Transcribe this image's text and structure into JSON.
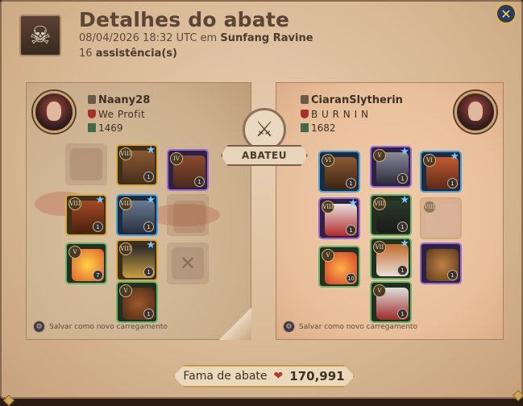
{
  "header": {
    "title": "Detalhes do abate",
    "datetime": "08/04/2026 18:32 UTC em",
    "location": "Sunfang Ravine",
    "assists_count": "16",
    "assists_label": "assistência(s)"
  },
  "center": {
    "label": "ABATEU"
  },
  "killer": {
    "name": "Naany28",
    "guild": "We Profit",
    "ip": "1469",
    "save_label": "Salvar como novo carregamento"
  },
  "victim": {
    "name": "CiaranSlytherin",
    "guild": "B U R N I N",
    "ip": "1682",
    "save_label": "Salvar como novo carregamento"
  },
  "killer_items": {
    "bag": {
      "tier": "",
      "count": ""
    },
    "head": {
      "tier": "VIII",
      "count": "1"
    },
    "cape": {
      "tier": "IV",
      "count": "1"
    },
    "weapon": {
      "tier": "VIII",
      "count": "1"
    },
    "armor": {
      "tier": "VIII",
      "count": "1"
    },
    "offhand": {
      "tier": "",
      "count": ""
    },
    "potion": {
      "tier": "V",
      "count": "7"
    },
    "shoes": {
      "tier": "VIII",
      "count": "1"
    },
    "food": {
      "tier": "",
      "count": ""
    },
    "mount": {
      "tier": "V",
      "count": "1"
    }
  },
  "victim_items": {
    "bag": {
      "tier": "VI",
      "count": "1"
    },
    "head": {
      "tier": "V",
      "count": "1"
    },
    "cape": {
      "tier": "VI",
      "count": "1"
    },
    "weapon": {
      "tier": "VIII",
      "count": "1"
    },
    "armor": {
      "tier": "VIII",
      "count": "1"
    },
    "offhand": {
      "tier": "VIII",
      "count": ""
    },
    "potion": {
      "tier": "V",
      "count": "10"
    },
    "shoes": {
      "tier": "VII",
      "count": "1"
    },
    "food": {
      "tier": "",
      "count": "1"
    },
    "mount": {
      "tier": "V",
      "count": "1"
    }
  },
  "fame": {
    "label": "Fama de abate",
    "value": "170,991"
  },
  "icons": {
    "header": "skull-crossbones-icon",
    "close": "close-icon",
    "center": "crossed-swords-icon",
    "fame": "kill-fame-icon",
    "save": "save-loadout-icon"
  },
  "colors": {
    "tier_blue": "#4aa0d6",
    "tier_purple": "#9b6ad0",
    "tier_gold": "#d9a83c",
    "tier_green": "#6ab56a",
    "accent_title": "#5a4637"
  }
}
